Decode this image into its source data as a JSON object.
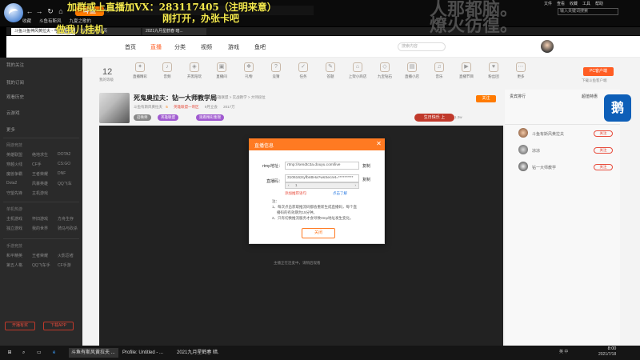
{
  "overlay": {
    "line1": "加群或上直播加VX：283117405（注明来意）",
    "line2": "刚打开，办张卡吧",
    "line3": "做我儿挂机",
    "ghost_line1": "人那都脑。",
    "ghost_line2": "燎火彷徨。"
  },
  "browser": {
    "address": "http://www.douyu.com/",
    "bookmarks": [
      "收藏",
      "斗鱼有斯风",
      "九夏之歌的"
    ],
    "tabs": [
      "斗鱼斗鱼神风黄拉夫 - 与一大师...",
      "直播公告 | 首页",
      "2021九月星鹤春 暗..."
    ],
    "search_placeholder": "输入关键词搜索",
    "menu_items": [
      "文件",
      "查看",
      "收藏",
      "工具",
      "帮助"
    ]
  },
  "site": {
    "logo": "斗鱼",
    "nav": [
      "首页",
      "直播",
      "分类",
      "视频",
      "游戏",
      "鱼吧"
    ],
    "search_placeholder": "搜索内容"
  },
  "sidebar": {
    "top_items": [
      "我的关注",
      "我的订阅",
      "观看历史",
      "云游戏",
      "更多"
    ],
    "sections": [
      {
        "title": "网游竞技",
        "groups": [
          "英雄联盟",
          "绝地求生",
          "DOTA2",
          "穿越火线",
          "CF手",
          "CS:GO",
          "魔兽争霸",
          "王者荣耀",
          "DNF",
          "Dota2",
          "风暴英雄",
          "QQ飞车",
          "守望先锋",
          "主机游戏"
        ]
      },
      {
        "title": "单机热游",
        "groups": [
          "主机游戏",
          "怀旧游戏",
          "方舟生存",
          "独立游戏",
          "我的世界",
          "骑马与砍杀"
        ]
      },
      {
        "title": "手游竞技",
        "groups": [
          "和平精英",
          "王者荣耀",
          "火影忍者",
          "第五人格",
          "QQ飞车手",
          "CF手游"
        ]
      }
    ],
    "btn_left": "开播有奖",
    "btn_right": "下载APP"
  },
  "main": {
    "stat_value": "12",
    "stat_label": "我的等级",
    "icons": [
      "直播精彩",
      "音频",
      "开黑陪玩",
      "直播间",
      "礼物",
      "竞猜",
      "任务",
      "答题",
      "上架小商店",
      "九宝钻石",
      "直播小店",
      "音乐",
      "直播节目",
      "粉丝团",
      "更多"
    ],
    "pc_button": "PC客户端",
    "pc_sub": "下载斗鱼客户端"
  },
  "room": {
    "title": "死鬼奥拉夫：钻一大师教学局",
    "meta": "斗鱼：英雄联盟 > 实战教学 > 大师段位",
    "host": "斗鱼有斯风黄拉夫",
    "level": "5",
    "rank": "英雄联盟一哥区",
    "viewers": "9月立会",
    "popularity": "2017万",
    "tags": [
      "召唤师",
      "英雄联盟",
      "观看精彩集锦"
    ],
    "follow": "关注",
    "badge": "生日快乐 上",
    "fans": "1.2w"
  },
  "player": {
    "hint": "主播正在连麦中，请稍后观看"
  },
  "dialog": {
    "title": "直播信息",
    "rtmp_label": "rtmp地址：",
    "rtmp_value": "rtmp://sendtc3a.douyu.com/live",
    "key_label": "直播码：",
    "key_value": "3106162ryfbnBHa?wsSecret=**********",
    "copy_label": "复制",
    "select_value": "1",
    "warning": "添加推荐语句",
    "warning_link": "点击了解",
    "notes": [
      "注：",
      "1、每次点击获取推流码都会重新生成直播码，每个直",
      "播码的有效期为15分钟。",
      "2、只有切换推流服务才会导致rtmp地址发生变化。"
    ],
    "confirm": "关闭"
  },
  "rpanel": {
    "tab_left": "贵宾排行",
    "tab_right": "超值特惠",
    "mascot": "鹅",
    "users": [
      {
        "name": "斗鱼有斯风黄拉夫",
        "action": "关注"
      },
      {
        "name": "凉凉",
        "action": "关注"
      },
      {
        "name": "钻一大师教学",
        "action": "关注"
      }
    ]
  },
  "taskbar": {
    "items": [
      "斗鱼有斯风黄拉夫 ...",
      "Profile: Untitled - ...",
      "2021九月星鹤春 暗..."
    ],
    "tray": "英 中",
    "time": "8:00",
    "date": "2021/7/18"
  }
}
